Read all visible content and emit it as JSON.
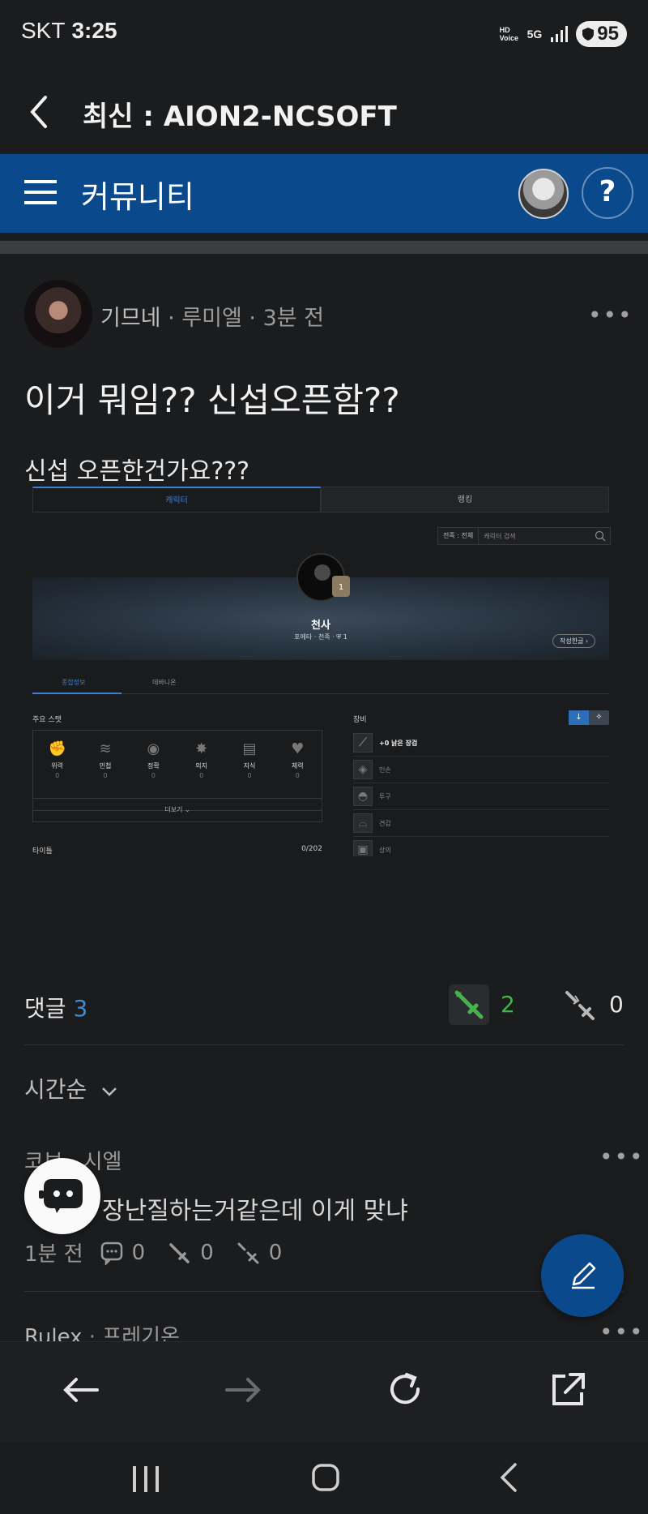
{
  "status": {
    "carrier": "SKT",
    "time": "3:25",
    "network": "5G",
    "hd_voice": "HD Voice",
    "battery": "95"
  },
  "topbar": {
    "title": "최신 : AION2-NCSOFT"
  },
  "community_bar": {
    "label": "커뮤니티",
    "help": "?"
  },
  "post": {
    "author": "기므네",
    "server": "루미엘",
    "time": "3분 전",
    "title": "이거 뭐임?? 신섭오픈함??",
    "body": "신섭 오픈한건가요???",
    "more": "•••",
    "embedded": {
      "tabs": [
        "캐릭터",
        "랭킹"
      ],
      "search_select": "전족 : 전체",
      "search_placeholder": "캐릭터 검색",
      "character_name": "천사",
      "character_sub": "포에타 · 천족 · ⛨ 1",
      "level_badge": "1",
      "write_button": "작성한글 ›",
      "subtabs": [
        "종합정보",
        "데바니온"
      ],
      "stats_title": "주요 스탯",
      "stats": [
        {
          "name": "위력",
          "value": "0",
          "icon": "fist-icon"
        },
        {
          "name": "민첩",
          "value": "0",
          "icon": "wing-icon"
        },
        {
          "name": "정확",
          "value": "0",
          "icon": "eye-icon"
        },
        {
          "name": "의지",
          "value": "0",
          "icon": "burst-icon"
        },
        {
          "name": "지식",
          "value": "0",
          "icon": "book-icon"
        },
        {
          "name": "체력",
          "value": "0",
          "icon": "heart-icon"
        }
      ],
      "more_label": "더보기 ⌄",
      "titles_label": "타이틀",
      "titles_count": "0/202",
      "equip_title": "장비",
      "equipment": [
        "+0 낡은 장검",
        "인손",
        "투구",
        "견갑",
        "상의"
      ]
    }
  },
  "reactions": {
    "comments_label": "댓글",
    "comments_count": "3",
    "likes": "2",
    "dislikes": "0"
  },
  "sort": {
    "label": "시간순"
  },
  "comments": [
    {
      "author": "코브",
      "server": "시엘",
      "body": "장난질하는거같은데 이게 맞냐",
      "time": "1분 전",
      "replies": "0",
      "likes": "0",
      "dislikes": "0"
    },
    {
      "author": "Rulex",
      "server": "프레기온"
    }
  ],
  "colors": {
    "accent": "#0a4a8c",
    "like_green": "#44b34a",
    "count_blue": "#3d8bd9",
    "background": "#1b1c1e"
  }
}
